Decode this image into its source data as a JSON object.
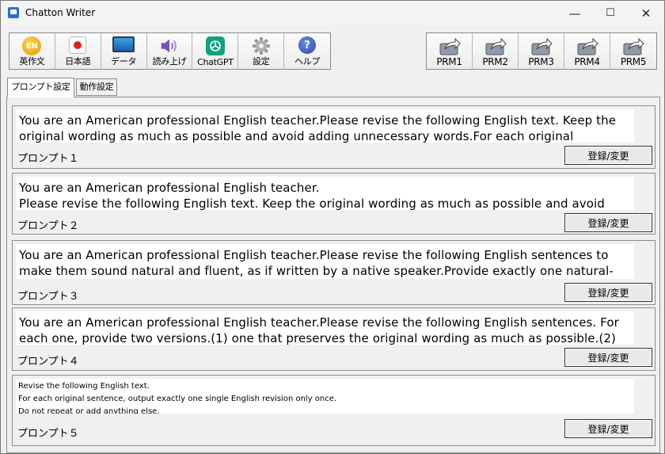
{
  "window": {
    "title": "Chatton Writer"
  },
  "titlebar_buttons": {
    "minimize": "—",
    "maximize": "☐",
    "close": "✕"
  },
  "toolbar": {
    "main_buttons": [
      {
        "label": "英作文",
        "icon": "en-coin-icon",
        "icon_text": "EN"
      },
      {
        "label": "日本語",
        "icon": "japan-flag-icon",
        "icon_text": ""
      },
      {
        "label": "データ",
        "icon": "monitor-data-icon",
        "icon_text": ""
      },
      {
        "label": "読み上げ",
        "icon": "speaker-icon",
        "icon_text": ""
      },
      {
        "label": "ChatGPT",
        "icon": "chatgpt-icon",
        "icon_text": ""
      },
      {
        "label": "設定",
        "icon": "gear-icon",
        "icon_text": ""
      },
      {
        "label": "ヘルプ",
        "icon": "help-icon",
        "icon_text": "?"
      }
    ],
    "prm_buttons": [
      {
        "label": "PRM1",
        "icon": "share-arrow-icon"
      },
      {
        "label": "PRM2",
        "icon": "share-arrow-icon"
      },
      {
        "label": "PRM3",
        "icon": "share-arrow-icon"
      },
      {
        "label": "PRM4",
        "icon": "share-arrow-icon"
      },
      {
        "label": "PRM5",
        "icon": "share-arrow-icon"
      }
    ]
  },
  "tabs": [
    {
      "label": "プロンプト設定",
      "active": true
    },
    {
      "label": "動作設定",
      "active": false
    }
  ],
  "prompts": [
    {
      "label": "プロンプト１",
      "text": "You are an American professional English teacher.Please revise the following English text. Keep the original wording as much as possible and avoid adding unnecessary words.For each original sentence,",
      "button": "登録/変更"
    },
    {
      "label": "プロンプト２",
      "text": "You are an American professional English teacher.\nPlease revise the following English text. Keep the original wording as much as possible and avoid",
      "button": "登録/変更"
    },
    {
      "label": "プロンプト３",
      "text": "You are an American professional English teacher.Please revise the following English sentences to make them sound natural and fluent, as if written by a native speaker.Provide exactly one natural-",
      "button": "登録/変更"
    },
    {
      "label": "プロンプト４",
      "text": "You are an American professional English teacher.Please revise the following English sentences. For each one, provide two versions.(1) one that preserves the original wording as much as possible.(2)",
      "button": "登録/変更"
    },
    {
      "label": "プロンプト５",
      "text": "Revise the following English text.\nFor each original sentence, output exactly one single English revision only once.\nDo not repeat or add anything else.",
      "button": "登録/変更"
    }
  ],
  "colors": {
    "accent_chatgpt": "#10a37f",
    "window_bg": "#f0f0f0"
  }
}
